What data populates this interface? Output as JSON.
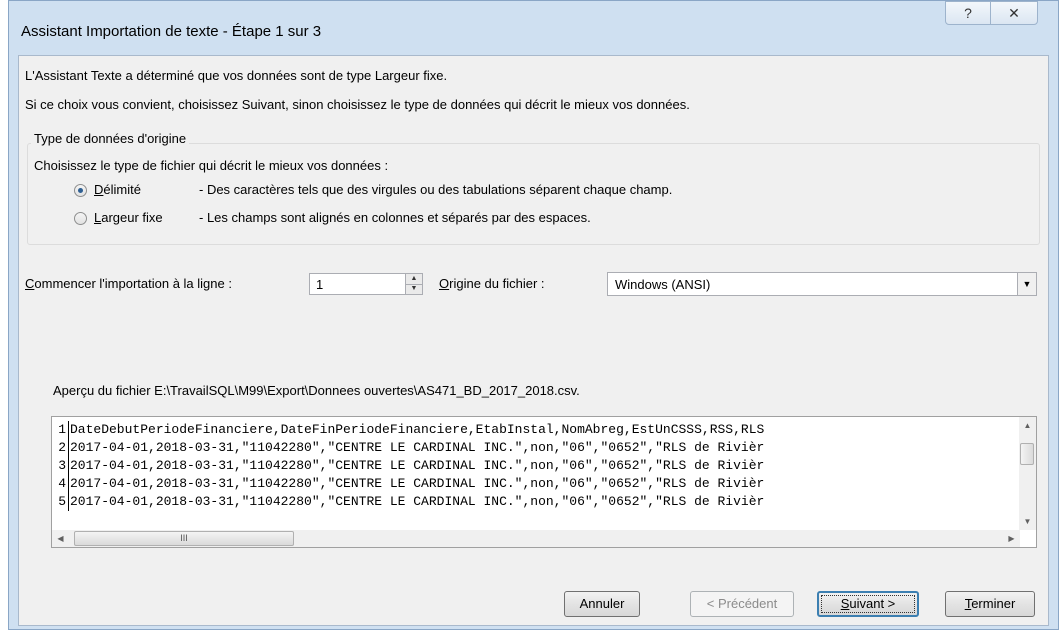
{
  "window": {
    "title": "Assistant Importation de texte - Étape 1 sur 3",
    "help_glyph": "?",
    "close_glyph": "✕"
  },
  "intro": {
    "line1": "L'Assistant Texte a déterminé que vos données sont de type Largeur fixe.",
    "line2": "Si ce choix vous convient, choisissez Suivant, sinon choisissez le type de données qui décrit le mieux vos données."
  },
  "group": {
    "legend": "Type de données d'origine",
    "prompt": "Choisissez le type de fichier qui décrit le mieux vos données :",
    "options": [
      {
        "label_first": "D",
        "label_rest": "élimité",
        "desc": "- Des caractères tels que des virgules ou des tabulations séparent chaque champ.",
        "checked": true
      },
      {
        "label_first": "L",
        "label_rest": "argeur fixe",
        "desc": "- Les champs sont alignés en colonnes et séparés par des espaces.",
        "checked": false
      }
    ]
  },
  "start_row": {
    "label_first": "C",
    "label_rest": "ommencer l'importation à la ligne :",
    "value": "1"
  },
  "origin": {
    "label_first": "O",
    "label_rest": "rigine du fichier :",
    "value": "Windows (ANSI)"
  },
  "preview": {
    "label": "Aperçu du fichier E:\\TravailSQL\\M99\\Export\\Donnees ouvertes\\AS471_BD_2017_2018.csv.",
    "rows": [
      {
        "num": "1",
        "text": "DateDebutPeriodeFinanciere,DateFinPeriodeFinanciere,EtabInstal,NomAbreg,EstUnCSSS,RSS,RLS"
      },
      {
        "num": "2",
        "text": "2017-04-01,2018-03-31,\"11042280\",\"CENTRE LE CARDINAL INC.\",non,\"06\",\"0652\",\"RLS de Rivièr"
      },
      {
        "num": "3",
        "text": "2017-04-01,2018-03-31,\"11042280\",\"CENTRE LE CARDINAL INC.\",non,\"06\",\"0652\",\"RLS de Rivièr"
      },
      {
        "num": "4",
        "text": "2017-04-01,2018-03-31,\"11042280\",\"CENTRE LE CARDINAL INC.\",non,\"06\",\"0652\",\"RLS de Rivièr"
      },
      {
        "num": "5",
        "text": "2017-04-01,2018-03-31,\"11042280\",\"CENTRE LE CARDINAL INC.\",non,\"06\",\"0652\",\"RLS de Rivièr"
      }
    ],
    "hthumb_grip": "III"
  },
  "buttons": {
    "cancel": "Annuler",
    "previous": "< Précédent",
    "next_first": "S",
    "next_rest": "uivant >",
    "finish_first": "T",
    "finish_rest": "erminer"
  }
}
